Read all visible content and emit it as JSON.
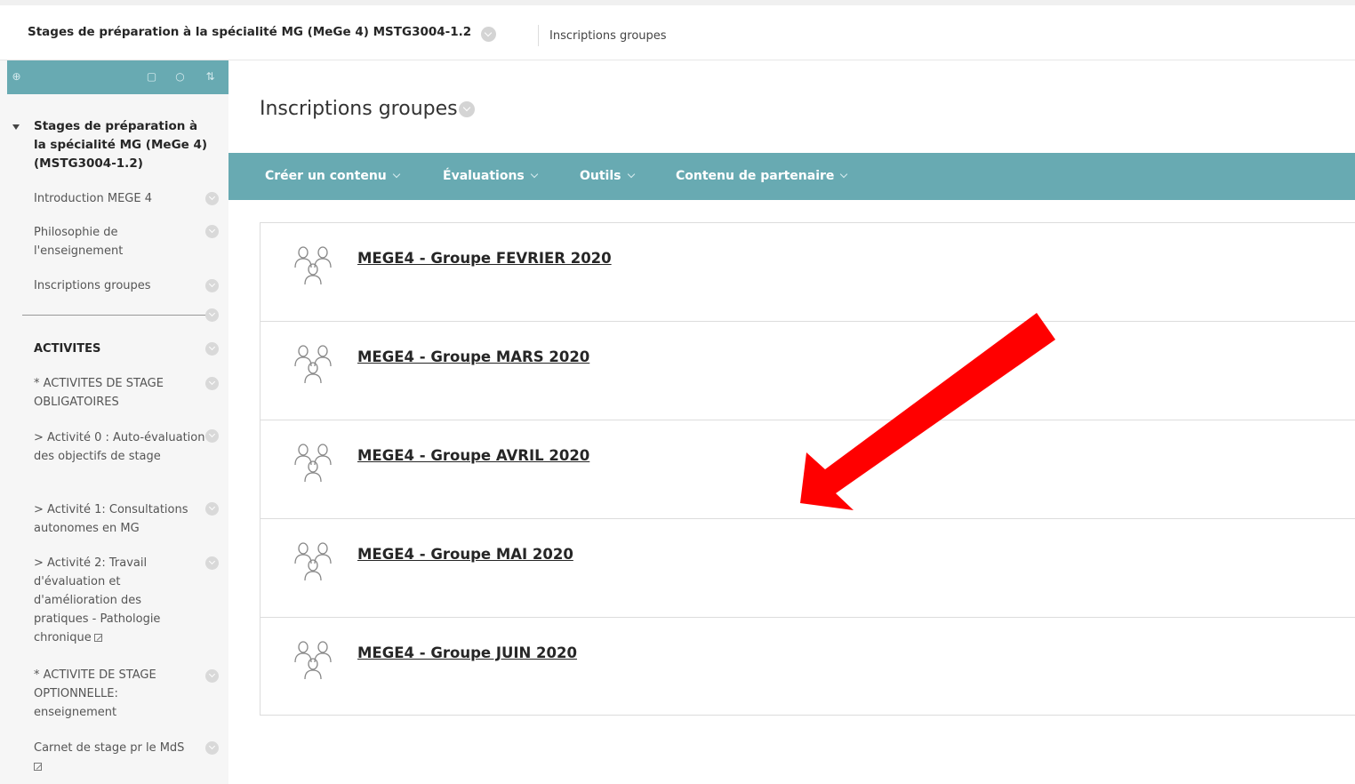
{
  "breadcrumb": {
    "course": "Stages de préparation à la spécialité MG (MeGe 4) MSTG3004-1.2",
    "page": "Inscriptions groupes"
  },
  "sidebar": {
    "course_title": "Stages de préparation à la spécialité MG (MeGe 4) (MSTG3004-1.2)",
    "items": [
      {
        "label": "Introduction MEGE 4"
      },
      {
        "label": "Philosophie de l'enseignement"
      },
      {
        "label": "Inscriptions groupes"
      },
      {
        "label": "ACTIVITES"
      },
      {
        "label": "* ACTIVITES DE STAGE OBLIGATOIRES"
      },
      {
        "label": "> Activité 0 : Auto-évaluation des objectifs de stage"
      },
      {
        "label": "> Activité 1: Consultations autonomes en MG"
      },
      {
        "label": "> Activité 2: Travail d'évaluation et d'amélioration des pratiques - Pathologie chronique"
      },
      {
        "label": "* ACTIVITE DE STAGE OPTIONNELLE: enseignement"
      },
      {
        "label": "Carnet de stage pr le MdS"
      }
    ]
  },
  "content": {
    "title": "Inscriptions groupes"
  },
  "action_bar": {
    "items": [
      {
        "label": "Créer un contenu"
      },
      {
        "label": "Évaluations"
      },
      {
        "label": "Outils"
      },
      {
        "label": "Contenu de partenaire"
      }
    ]
  },
  "groups": [
    {
      "label": "MEGE4 - Groupe FEVRIER 2020"
    },
    {
      "label": "MEGE4 - Groupe MARS 2020"
    },
    {
      "label": "MEGE4 - Groupe AVRIL 2020"
    },
    {
      "label": "MEGE4 - Groupe MAI 2020"
    },
    {
      "label": "MEGE4 - Groupe JUIN 2020"
    }
  ],
  "colors": {
    "accent": "#68aab2",
    "annotation_arrow": "#ff0000"
  },
  "icons": [
    "chevron-down-icon",
    "add-icon",
    "folder-icon",
    "refresh-icon",
    "sort-icon",
    "group-icon",
    "external-link-icon"
  ]
}
